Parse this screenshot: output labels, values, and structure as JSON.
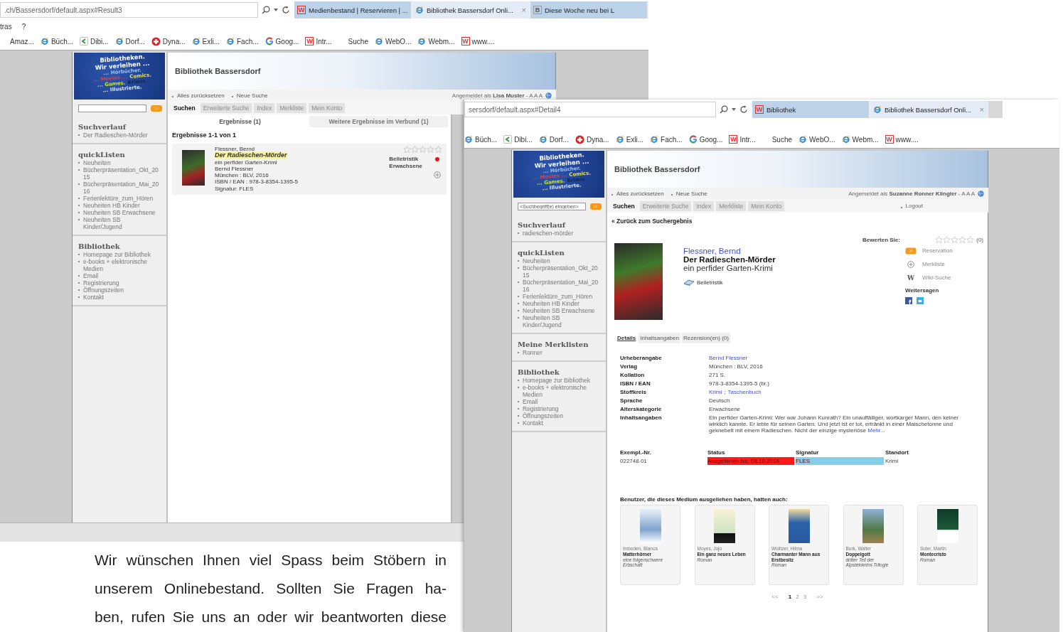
{
  "windows": [
    {
      "address": ".ch/Bassersdorf/default.aspx#Result3",
      "tabs": [
        {
          "kind": "w",
          "badge": "W",
          "title": "Medienbestand | Reservieren | ...",
          "selected": false
        },
        {
          "kind": "ie",
          "title": "Bibliothek Bassersdorf Onli...",
          "close": "×",
          "selected": true
        },
        {
          "kind": "b",
          "badge": "B",
          "title": "Diese Woche neu bei L",
          "selected": false
        }
      ],
      "menu": [
        "tras",
        "?"
      ],
      "favorites": [
        {
          "kind": "none",
          "label": "Amaz..."
        },
        {
          "kind": "ie",
          "label": "Büch..."
        },
        {
          "kind": "arrow",
          "label": "Dibi..."
        },
        {
          "kind": "ie",
          "label": "Dorf..."
        },
        {
          "kind": "plus",
          "label": "Dyna..."
        },
        {
          "kind": "ie",
          "label": "Exli..."
        },
        {
          "kind": "ie",
          "label": "Fach..."
        },
        {
          "kind": "google",
          "label": "Goog..."
        },
        {
          "kind": "w",
          "badge": "W",
          "label": "Intr..."
        },
        {
          "kind": "none",
          "label": "Suche"
        },
        {
          "kind": "ie",
          "label": "WebO..."
        },
        {
          "kind": "ie",
          "label": "Webm..."
        },
        {
          "kind": "w",
          "badge": "W",
          "label": "www...."
        }
      ],
      "page": {
        "logo": [
          [
            {
              "text": "Bibliotheken.",
              "color": "#ffffff"
            }
          ],
          [
            {
              "text": "Wir verleihen ...",
              "color": "#ffffff"
            }
          ],
          [
            {
              "text": "... Hörbücher.",
              "color": "#9fc3f5"
            }
          ],
          [
            {
              "text": "... Movies ...",
              "color": "#e0413a"
            },
            {
              "text": "Comics.",
              "color": "#f0e040"
            }
          ],
          [
            {
              "text": "... Games.",
              "color": "#c8e040"
            },
            {
              "text": "Krimis.",
              "color": "#14224a"
            }
          ],
          [
            {
              "text": "... Illustrierte.",
              "color": "#d8e4ff"
            }
          ]
        ],
        "site_title": "Bibliothek Bassersdorf",
        "links": [
          "Alles zurücksetzen",
          "Neue Suche"
        ],
        "login": {
          "prefix": "Angemeldet als",
          "user": "Lisa Muster",
          "suffix": "- A A A"
        },
        "nav_tabs": [
          {
            "label": "Suchen",
            "selected": true
          },
          {
            "label": "Erweiterte Suche",
            "selected": false
          },
          {
            "label": "Index",
            "selected": false
          },
          {
            "label": "Merkliste",
            "selected": false
          },
          {
            "label": "Mein Konto",
            "selected": false
          }
        ],
        "sidebar": [
          {
            "heading": "Suchverlauf",
            "items": [
              "Der Radieschen-Mörder"
            ]
          },
          {
            "heading": "quickListen",
            "items": [
              "Neuheiten",
              "Bücherpräsentation_Okt_2015",
              "Bücherpräsentation_Mai_2016",
              "Ferienlektüre_zum_Hören",
              "Neuheiten HB Kinder",
              "Neuheiten SB Erwachsene",
              "Neuheiten SB Kinder/Jugend"
            ]
          },
          {
            "heading": "Bibliothek",
            "items": [
              "Homepage zur Bibliothek",
              "e-books + elektronische Medien",
              "Email",
              "Registrierung",
              "Öffnungszeiten",
              "Kontakt"
            ]
          }
        ],
        "view": {
          "kind": "results",
          "result_tabs": [
            {
              "label": "Ergebnisse (1)",
              "selected": true
            },
            {
              "label": "Weitere Ergebnisse im Verbund (1)",
              "selected": false
            }
          ],
          "count": "Ergebnisse 1-1 von 1",
          "results": [
            {
              "author": "Flessner, Bernd",
              "title": "Der Radieschen-Mörder",
              "details": [
                "ein perfider Garten-Krimi",
                "Bernd Flessner",
                "München : BLV, 2016",
                "ISBN / EAN : 978-3-8354-1395-5",
                "Signatur: FLES"
              ],
              "stars": 0,
              "genre": "Belletristik",
              "audience": "Erwachsene",
              "color": "#e8151b"
            }
          ]
        }
      }
    },
    {
      "address": "sersdorf/default.aspx#Detail4",
      "tabs": [
        {
          "kind": "w",
          "badge": "W",
          "title": "Bibliothek",
          "selected": false
        },
        {
          "kind": "ie",
          "title": "Bibliothek Bassersdorf Onli...",
          "close": "×",
          "selected": true
        }
      ],
      "favorites": [
        {
          "kind": "ie",
          "label": "Büch..."
        },
        {
          "kind": "arrow",
          "label": "Dibi..."
        },
        {
          "kind": "ie",
          "label": "Dorf..."
        },
        {
          "kind": "plus",
          "label": "Dyna..."
        },
        {
          "kind": "ie",
          "label": "Exli..."
        },
        {
          "kind": "ie",
          "label": "Fach..."
        },
        {
          "kind": "google",
          "label": "Goog..."
        },
        {
          "kind": "w",
          "badge": "W",
          "label": "Intr..."
        },
        {
          "kind": "none",
          "label": "Suche"
        },
        {
          "kind": "ie",
          "label": "WebO..."
        },
        {
          "kind": "ie",
          "label": "Webm..."
        },
        {
          "kind": "w",
          "badge": "W",
          "label": "www...."
        }
      ],
      "page": {
        "logo": [
          [
            {
              "text": "Bibliotheken.",
              "color": "#ffffff"
            }
          ],
          [
            {
              "text": "Wir verleihen ...",
              "color": "#ffffff"
            }
          ],
          [
            {
              "text": "... Hörbücher.",
              "color": "#9fc3f5"
            }
          ],
          [
            {
              "text": "... Movies ...",
              "color": "#e0413a"
            },
            {
              "text": "Comics.",
              "color": "#f0e040"
            }
          ],
          [
            {
              "text": "... Games.",
              "color": "#c8e040"
            },
            {
              "text": "Krimis.",
              "color": "#14224a"
            }
          ],
          [
            {
              "text": "... Illustrierte.",
              "color": "#d8e4ff"
            }
          ]
        ],
        "site_title": "Bibliothek Bassersdorf",
        "links": [
          "Alles zurücksetzen",
          "Neue Suche"
        ],
        "login": {
          "prefix": "Angemeldet als",
          "user": "Suzanne Ronner Klingler",
          "suffix": "- A A A"
        },
        "search": {
          "placeholder": "<Suchbegriff(e) eingeben>"
        },
        "nav_tabs": [
          {
            "label": "Suchen",
            "selected": true
          },
          {
            "label": "Erweiterte Suche",
            "selected": false
          },
          {
            "label": "Index",
            "selected": false
          },
          {
            "label": "Merkliste",
            "selected": false
          },
          {
            "label": "Mein Konto",
            "selected": false
          }
        ],
        "logout": "Logout",
        "sidebar": [
          {
            "heading": "Suchverlauf",
            "items": [
              "radieschen-mörder"
            ]
          },
          {
            "heading": "quickListen",
            "items": [
              "Neuheiten",
              "Bücherpräsentation_Okt_2015",
              "Bücherpräsentation_Mai_2016",
              "Ferienlektüre_zum_Hören",
              "Neuheiten HB Kinder",
              "Neuheiten SB Erwachsene",
              "Neuheiten SB Kinder/Jugend"
            ]
          },
          {
            "heading": "Meine Merklisten",
            "items": [
              "Ronner"
            ]
          },
          {
            "heading": "Bibliothek",
            "items": [
              "Homepage zur Bibliothek",
              "e-books + elektronische Medien",
              "Email",
              "Registrierung",
              "Öffnungszeiten",
              "Kontakt"
            ]
          }
        ],
        "view": {
          "kind": "detail",
          "back": "« Zurück zum Suchergebnis",
          "rating": {
            "label": "Bewerten Sie:",
            "stars": 0,
            "count": "(0)"
          },
          "author": "Flessner, Bernd",
          "title": "Der Radieschen-Mörder",
          "subtitle": "ein perfider Garten-Krimi",
          "genre": "Belletristik",
          "actions": [
            {
              "kind": "reserve",
              "label": "Reservation"
            },
            {
              "kind": "watchlist",
              "label": "Merkliste"
            },
            {
              "kind": "wiki",
              "badge": "W",
              "label": "Wiki-Suche"
            }
          ],
          "share_heading": "Weitersagen",
          "detail_tabs": [
            {
              "label": "Details",
              "selected": true
            },
            {
              "label": "Inhaltsangaben",
              "selected": false
            },
            {
              "label": "Rezension(en) (0)",
              "selected": false
            }
          ],
          "fields": [
            {
              "kind": "link",
              "label": "Urheberangabe",
              "values": [
                "Bernd Flessner"
              ]
            },
            {
              "kind": "text",
              "label": "Verlag",
              "values": [
                "München : BLV, 2016"
              ]
            },
            {
              "kind": "text",
              "label": "Kollation",
              "values": [
                "271 S."
              ]
            },
            {
              "kind": "text",
              "label": "ISBN / EAN",
              "values": [
                "978-3-8354-1395-5 (br.)"
              ]
            },
            {
              "kind": "link",
              "label": "Stoffkreis",
              "values": [
                "Krimi",
                "Taschenbuch"
              ],
              "separator": ";"
            },
            {
              "kind": "text",
              "label": "Sprache",
              "values": [
                "Deutsch"
              ]
            },
            {
              "kind": "text",
              "label": "Alterskategorie",
              "values": [
                "Erwachsene"
              ]
            },
            {
              "kind": "summary",
              "label": "Inhaltsangaben",
              "values": [
                "Ein perfider Garten-Krimi: Wer war Johann Kunrath? Ein unauffälliger, wortkarger Mann, den keiner wirklich kannte. Er lebte für seinen Garten. Und jetzt ist er tot, ertränkt in einer Maischetonne und geknebelt mit einem Radieschen. Nicht der einzige mysteriöse"
              ],
              "more": "Mehr..."
            }
          ],
          "copies": {
            "columns": [
              "Exempl.-Nr.",
              "Status",
              "Signatur",
              "Standort"
            ],
            "rows": [
              {
                "cells": [
                  {
                    "text": "022748.01"
                  },
                  {
                    "text": "Ausgeliehen bis: 08.10.2016",
                    "color": "#ff1a1a"
                  },
                  {
                    "text": "FLES",
                    "color": "#87ceeb"
                  },
                  {
                    "text": "Krimi"
                  }
                ]
              }
            ]
          },
          "recommendations": {
            "heading": "Benutzer, die dieses Medium ausgeliehen haben, hatten auch:",
            "items": [
              {
                "author": "Imboden, Blanca",
                "title": "Matterhörner",
                "subtitle": "eine folgenschwere Erbschaft"
              },
              {
                "author": "Moyes, Jojo",
                "title": "Ein ganz neues Leben",
                "subtitle": "Roman"
              },
              {
                "author": "Wolitzer, Hilma",
                "title": "Charmanter Mann aus Erstbesitz",
                "subtitle": "Roman"
              },
              {
                "author": "Burk, Walter",
                "title": "Doppelgott",
                "subtitle": "dritter Teil der Alpsteinkrimi-Trilogie"
              },
              {
                "author": "Suter, Martin",
                "title": "Montecristo",
                "subtitle": "Roman"
              }
            ]
          },
          "pagination": {
            "prev": "<<",
            "pages": [
              {
                "label": "1",
                "selected": true
              },
              {
                "label": "2",
                "selected": false
              },
              {
                "label": "3",
                "selected": false
              }
            ],
            "next": ">>"
          }
        }
      }
    }
  ],
  "document_text": {
    "lines": [
      "Wir wünschen Ihnen viel Spass beim Stöbern in",
      "unserem Onlinebestand. Sollten Sie Fragen ha-",
      "ben, rufen Sie uns an oder wir beantworten diese"
    ]
  }
}
